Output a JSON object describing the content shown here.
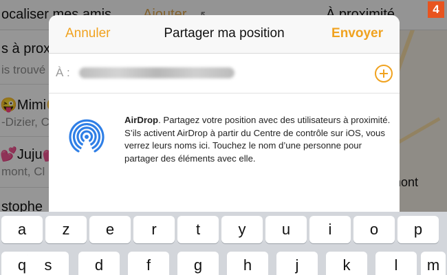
{
  "background": {
    "header_left": "ocaliser mes amis",
    "header_mid": "Ajouter",
    "header_right": "À proximité",
    "rows": [
      {
        "name": "s à prox",
        "sub": "is trouvé"
      },
      {
        "name": "😜Mimi😜",
        "sub": "-Dizier, C"
      },
      {
        "name": "💕Juju💕",
        "sub": "mont, Cl"
      },
      {
        "name": "stophe",
        "sub": ""
      }
    ],
    "map_label": "mont"
  },
  "badge": "4",
  "sheet": {
    "cancel_label": "Annuler",
    "title": "Partager ma position",
    "send_label": "Envoyer",
    "to_label": "À :",
    "airdrop_name": "AirDrop",
    "airdrop_desc": ". Partagez votre position avec des utilisateurs à proximité. S’ils activent AirDrop à partir du Centre de contrôle sur iOS, vous verrez leurs noms ici. Touchez le nom d’une personne pour partager des éléments avec elle."
  },
  "colors": {
    "accent": "#f0a21f",
    "airdrop_blue": "#2f7fe6",
    "badge": "#e8541f"
  },
  "keyboard": {
    "row1": [
      "a",
      "z",
      "e",
      "r",
      "t",
      "y",
      "u",
      "i",
      "o",
      "p"
    ],
    "row2": [
      "q",
      "s",
      "d",
      "f",
      "g",
      "h",
      "j",
      "k",
      "l",
      "m"
    ]
  }
}
